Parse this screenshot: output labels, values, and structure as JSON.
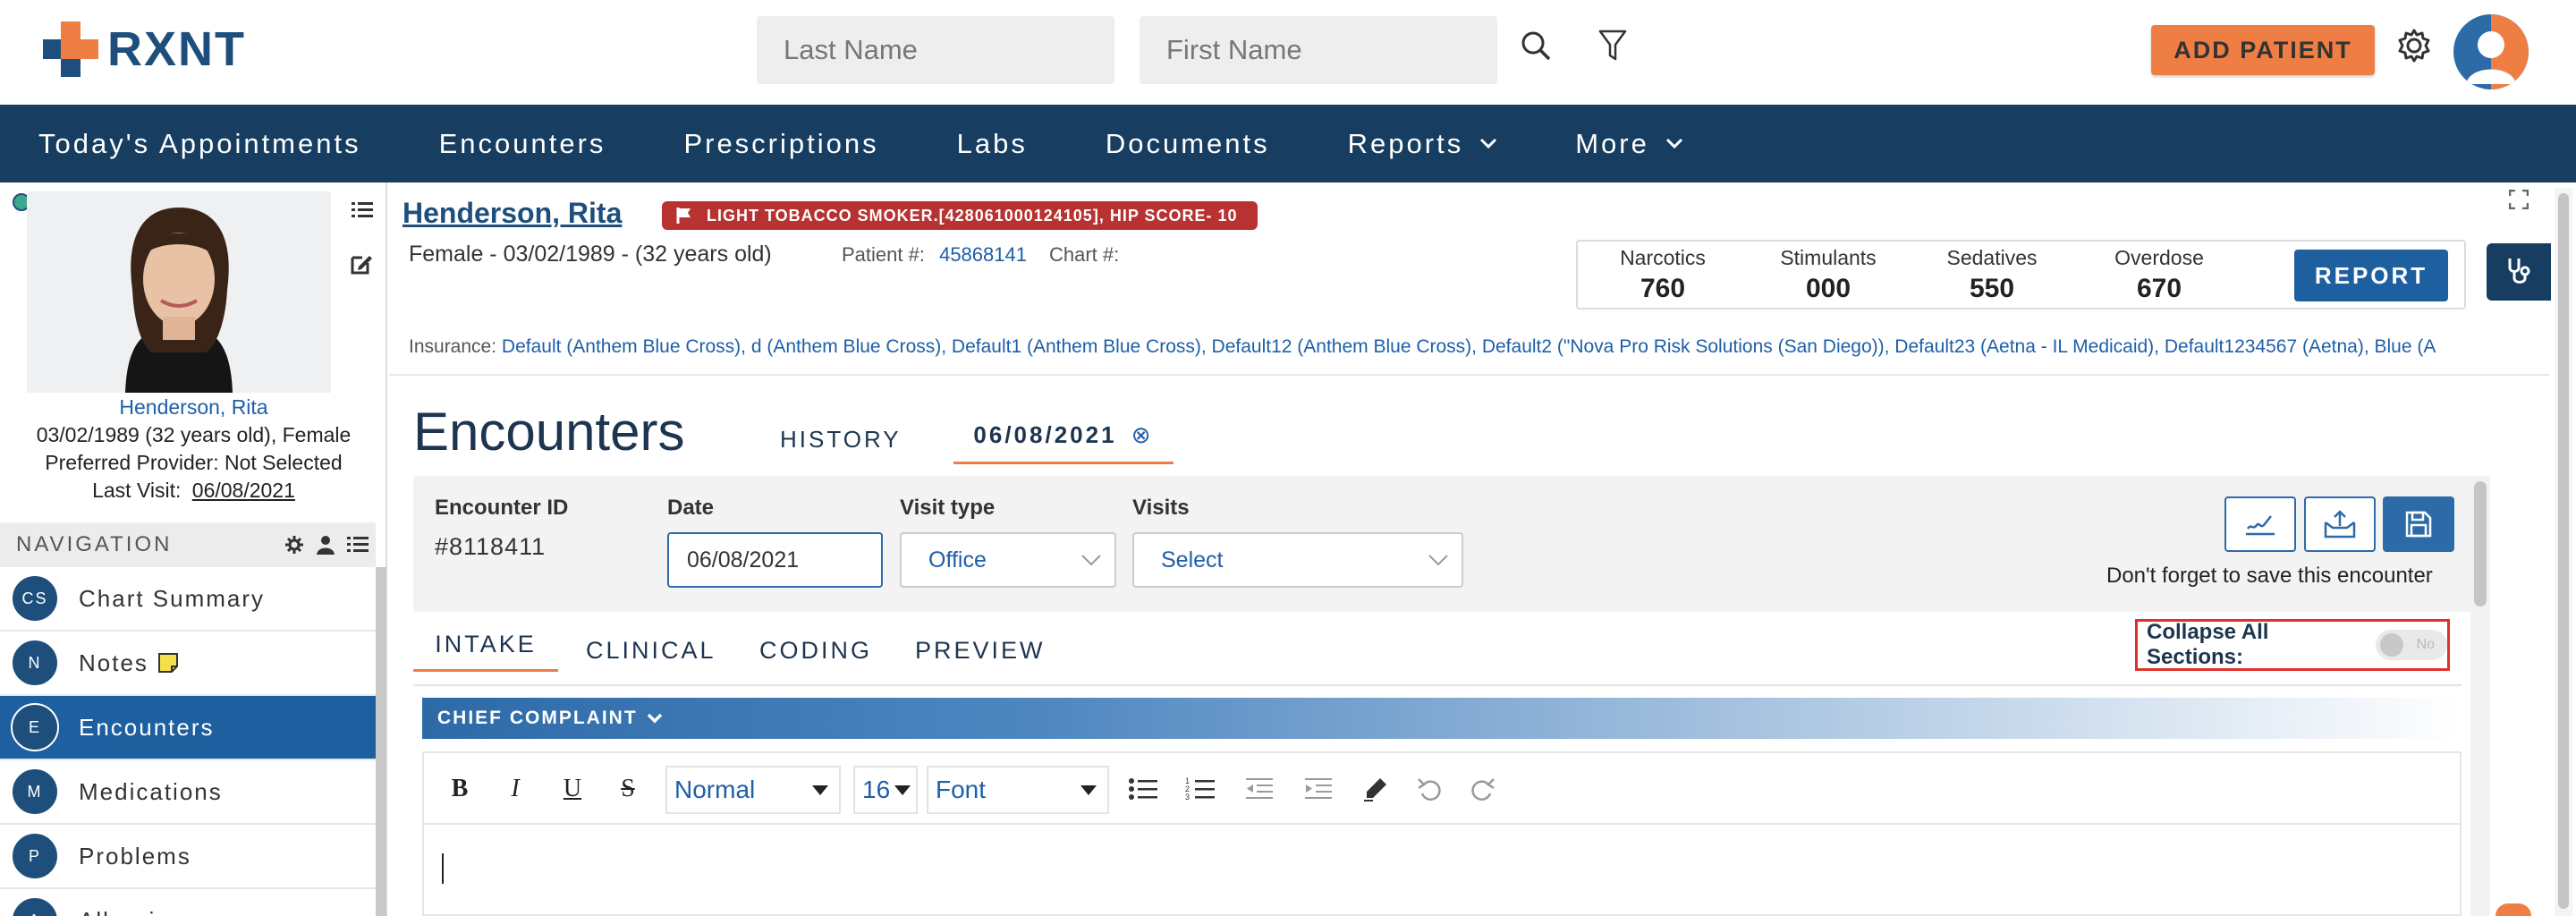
{
  "header": {
    "logo_text": "RXNT",
    "last_name_placeholder": "Last Name",
    "first_name_placeholder": "First Name",
    "add_patient_label": "ADD PATIENT"
  },
  "main_nav": {
    "items": [
      {
        "label": "Today's Appointments"
      },
      {
        "label": "Encounters"
      },
      {
        "label": "Prescriptions"
      },
      {
        "label": "Labs"
      },
      {
        "label": "Documents"
      },
      {
        "label": "Reports"
      },
      {
        "label": "More"
      }
    ]
  },
  "patient_card": {
    "name": "Henderson, Rita",
    "dob_line": "03/02/1989 (32 years old), Female",
    "provider_line": "Preferred Provider: Not Selected",
    "last_visit_label": "Last Visit:",
    "last_visit_value": "06/08/2021"
  },
  "side_nav": {
    "header": "NAVIGATION",
    "items": [
      {
        "badge": "CS",
        "label": "Chart Summary"
      },
      {
        "badge": "N",
        "label": "Notes"
      },
      {
        "badge": "E",
        "label": "Encounters"
      },
      {
        "badge": "M",
        "label": "Medications"
      },
      {
        "badge": "P",
        "label": "Problems"
      },
      {
        "badge": "A",
        "label": "Allergies"
      }
    ]
  },
  "patient_header": {
    "name": "Henderson, Rita",
    "alert": "LIGHT TOBACCO SMOKER.[428061000124105], HIP SCORE- 10",
    "demographics": "Female - 03/02/1989 - (32 years old)",
    "patient_no_label": "Patient #:",
    "patient_no_value": "45868141",
    "chart_no_label": "Chart #:",
    "insurance_label": "Insurance:",
    "insurance_value": "Default (Anthem Blue Cross), d (Anthem Blue Cross), Default1 (Anthem Blue Cross), Default12 (Anthem Blue Cross), Default2 (\"Nova Pro Risk Solutions (San Diego)), Default23 (Aetna - IL Medicaid), Default1234567 (Aetna), Blue (A"
  },
  "pdmp": {
    "scores": [
      {
        "label": "Narcotics",
        "value": "760"
      },
      {
        "label": "Stimulants",
        "value": "000"
      },
      {
        "label": "Sedatives",
        "value": "550"
      },
      {
        "label": "Overdose",
        "value": "670"
      }
    ],
    "report_label": "REPORT"
  },
  "encounter": {
    "title": "Encounters",
    "tab_history": "HISTORY",
    "tab_date": "06/08/2021",
    "id_label": "Encounter ID",
    "id_value": "#8118411",
    "date_label": "Date",
    "date_value": "06/08/2021",
    "visit_type_label": "Visit type",
    "visit_type_value": "Office",
    "visits_label": "Visits",
    "visits_value": "Select",
    "save_note": "Don't forget to save this encounter",
    "subtabs": [
      "INTAKE",
      "CLINICAL",
      "CODING",
      "PREVIEW"
    ],
    "collapse_label": "Collapse All Sections:",
    "collapse_toggle": "No",
    "section_title": "CHIEF COMPLAINT"
  },
  "editor_toolbar": {
    "paragraph_style": "Normal",
    "font_size": "16",
    "font_family": "Font"
  },
  "colors": {
    "brand_dark": "#173d60",
    "brand_blue": "#1e5fa0",
    "accent_orange": "#ef7e45",
    "alert_red": "#b83232"
  }
}
